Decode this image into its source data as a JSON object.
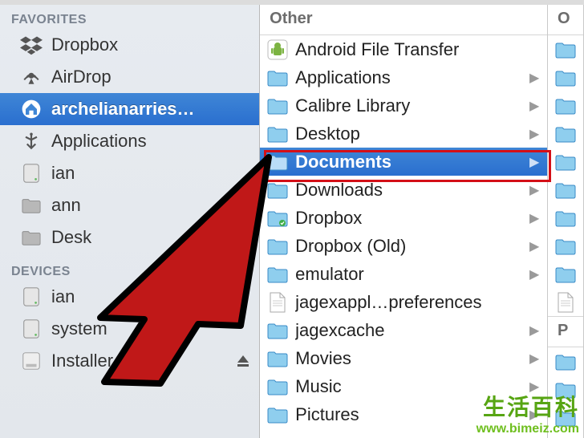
{
  "sidebar": {
    "sections": {
      "favorites": {
        "header": "FAVORITES"
      },
      "devices": {
        "header": "DEVICES"
      }
    },
    "favorites_items": [
      {
        "label": "Dropbox",
        "icon": "dropbox"
      },
      {
        "label": "AirDrop",
        "icon": "airdrop"
      },
      {
        "label": "archelianarries…",
        "icon": "home",
        "selected": true
      },
      {
        "label": "Applications",
        "icon": "apps"
      },
      {
        "label": "ian",
        "icon": "hd"
      },
      {
        "label": "ann",
        "icon": "folder-gray"
      },
      {
        "label": "Desk",
        "icon": "folder-gray"
      }
    ],
    "devices_items": [
      {
        "label": "ian",
        "icon": "hd"
      },
      {
        "label": "system",
        "icon": "hd"
      },
      {
        "label": "Installer",
        "icon": "disk",
        "eject": true
      }
    ]
  },
  "columns": {
    "main": {
      "header": "Other",
      "items": [
        {
          "label": "Android File Transfer",
          "icon": "app-android",
          "chev": false
        },
        {
          "label": "Applications",
          "icon": "folder",
          "chev": true
        },
        {
          "label": "Calibre Library",
          "icon": "folder",
          "chev": true
        },
        {
          "label": "Desktop",
          "icon": "folder",
          "chev": true
        },
        {
          "label": "Documents",
          "icon": "folder",
          "chev": true,
          "selected": true,
          "highlight": true
        },
        {
          "label": "Downloads",
          "icon": "folder",
          "chev": true
        },
        {
          "label": "Dropbox",
          "icon": "folder-dropbox",
          "chev": true
        },
        {
          "label": "Dropbox (Old)",
          "icon": "folder",
          "chev": true
        },
        {
          "label": "emulator",
          "icon": "folder",
          "chev": true
        },
        {
          "label": "jagexappl…preferences",
          "icon": "file",
          "chev": false
        },
        {
          "label": "jagexcache",
          "icon": "folder",
          "chev": true
        },
        {
          "label": "Movies",
          "icon": "folder",
          "chev": true
        },
        {
          "label": "Music",
          "icon": "folder",
          "chev": true
        },
        {
          "label": "Pictures",
          "icon": "folder",
          "chev": true
        }
      ]
    },
    "right": {
      "header": "O",
      "peek_header2": "P",
      "items_count": 13
    }
  },
  "watermark": {
    "line1": "生活百科",
    "line2": "www.bimeiz.com"
  },
  "colors": {
    "selection_top": "#3f86d6",
    "selection_bottom": "#2a6fcf",
    "highlight_border": "#d40f17",
    "folder_blue": "#79c3ef"
  }
}
